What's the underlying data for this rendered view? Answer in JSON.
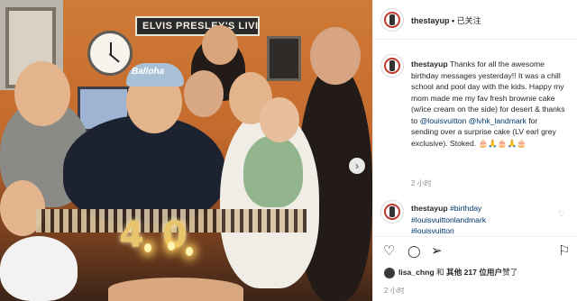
{
  "photo": {
    "sign_text": "ELVIS PRESLEY'S LIVING",
    "cap_text": "Balloha",
    "balloons": [
      "4",
      "0"
    ],
    "next_icon": "›"
  },
  "header": {
    "username": "thestayup",
    "separator": " • ",
    "follow_status": "已关注"
  },
  "caption": {
    "username": "thestayup",
    "text_1": " Thanks for all the awesome birthday messages yesterday!! It was a chill school and pool day with the kids. Happy my mom made me my fav fresh brownie cake (w/ice cream on the side) for desert & thanks to ",
    "mention_1": "@louisvuitton",
    "text_2": " ",
    "mention_2": "@lvhk_landmark",
    "text_3": " for sending over a surprise cake (LV earl grey exclusive). Stoked. 🎂🙏🎂🙏🎂",
    "time": "2 小时"
  },
  "comment": {
    "username": "thestayup",
    "tag_1": "#birthday",
    "tag_2": "#louisvuittonlandmark",
    "tag_3": "#louisvuitton",
    "time": "2 小时",
    "like_icon": "♡"
  },
  "actions": {
    "like_icon": "♡",
    "comment_icon": "◯",
    "share_icon": "➢",
    "save_icon": "⚐"
  },
  "likes": {
    "user": "lisa_chng",
    "and": " 和 ",
    "count_text": "其他 217 位用户",
    "suffix": "赞了"
  },
  "post_time": "2 小时",
  "colors": {
    "link": "#00376b",
    "muted": "#8e8e8e",
    "wall": "#c46a2e"
  }
}
